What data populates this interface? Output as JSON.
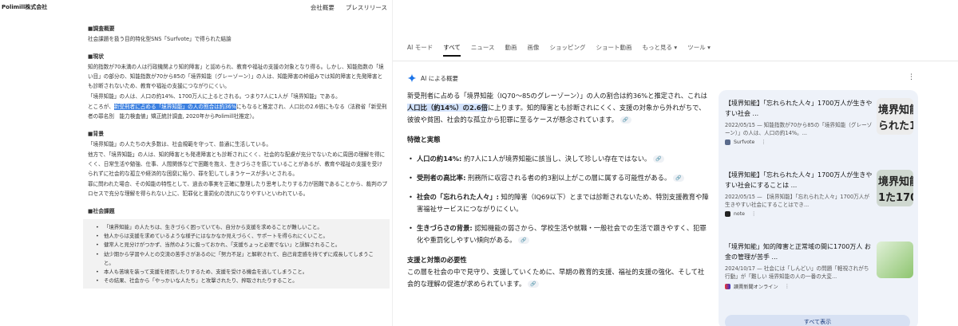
{
  "left": {
    "brand": "Polimill株式会社",
    "nav": [
      "会社概要",
      "プレスリリース"
    ],
    "sections": {
      "title_h": "■調査概要",
      "title_p": "社会課題を扱う目的特化型SNS「Surfvote」で得られた結論",
      "current_h": "■現状",
      "current_p1": "知的指数が70未満の人は行政機関より知的障害」と認められ、教育や福祉の支援の対象となり得る。しかし、知能指数の「境い目」の部分の、知能指数が70から85の「境界知能（グレーゾーン）」の人は、知能障害の枠組みでは知的障害と先発障害とも診断されないため、教育や福祉の支援につながりにくい。",
      "current_p2": "「境界知能」の人は、人口の約14%、1700万人に上るとされる。つまり7人に1人が「境界知能」である。",
      "current_p3a": "ところが、",
      "current_p3_hl": "新受刑者に占める「境界知能」の人の割合は約36%",
      "current_p3b": "にもなると推定され、人口比の2.6倍にもなる（法務省「新受刑者の罪名別　能力検査値」矯正統計調査, 2020年からPolimill社推定）。",
      "bg_h": "■背景",
      "bg_p1": "「境界知能」の人たちの大多数は、社会規範を守って、普通に生活している。",
      "bg_p2": "他方で、「境界知能」の人は、知的障害とも発達障害とも診断されにくく、社会的な配慮が充分でないために周囲の理解を得にくく、日常生活や勉強、仕事、人間関係などで困難を抱え、生きづらさを感じていることがあるが、教育や福祉の支援を受けられずに社会的な孤立や経済的な困窮に陥り、罪を犯してしまうケースが多いとされる。",
      "bg_p3": "罪に問われた場合、その知能の特性として、過去の事実を正確に整理したり思考したりする力が困難であることから、裁判のプロセスで充分な理解を得られない上に、犯罪化と重罰化の流れになりやすいといわれている。",
      "issues_h": "■社会課題",
      "issues": [
        "「境界知能」の人たちは、生きづらく困っていても、自分から支援を求めることが難しいこと。",
        "他人からは支援を求めているような様子にはなかなか見えづらく、サポートを得られにくいこと。",
        "健常人と見分けがつかず、当然のように扱っておかれ、「支援ちょっと必要でない」と誤解されること。",
        "幼少期から学習や人との交流の苦手さがあるのに「努力不足」と解釈されて、自己肯定感を持てずに成長してしまうこと。",
        "本人も苦境を装って支援を拒否したりするため、支援を受ける機会を逃してしまうこと。",
        "その結果、社会から「やっかいな人たち」と攻撃されたり、搾取されたりすること。"
      ]
    }
  },
  "right": {
    "tabs": [
      "AI モード",
      "すべて",
      "ニュース",
      "動画",
      "画像",
      "ショッピング",
      "ショート動画",
      "もっと見る ▾",
      "ツール ▾"
    ],
    "ai_label": "AI による概要",
    "intro_a": "新受刑者に占める「境界知能（IQ70〜85のグレーゾーン）」の人の割合は約36%と推定され、これは",
    "intro_hl": "人口比（約14%）の2.6倍",
    "intro_b": "に上ります。知的障害とも診断されにくく、支援の対象から外れがちで、彼彼や貧困、社会的な孤立から犯罪に至るケースが懸念されています。",
    "features_h": "特徴と実態",
    "bullets": [
      {
        "b": "人口の約14%:",
        "t": "約7人に1人が境界知能に該当し、決して珍しい存在ではない。"
      },
      {
        "b": "受刑者の高比率:",
        "t": "刑務所に収容される者の約3割以上がこの層に属する可能性がある。"
      },
      {
        "b": "社会の「忘れられた人々」:",
        "t": "知的障害（IQ69以下）とまでは診断されないため、特別支援教育や障害福祉サービスにつながりにくい。"
      },
      {
        "b": "生きづらさの背景:",
        "t": "認知機能の弱さから、学校生活や就職・一般社会での生活で躓きやすく、犯罪化や重罰化しやすい傾向がある。"
      }
    ],
    "support_h": "支援と対策の必要性",
    "support_p": "この層を社会の中で見守り、支援していくために、早期の教育的支援、福祉的支援の強化、そして社会的な理解の促進が求められています。",
    "chip": "🔗",
    "kebab": "⋮",
    "cards": [
      {
        "title": "【境界知能】「忘れられた人々」1700万人が生きやすい社会 ...",
        "snippet": "2022/05/15 — 知能指数が70から85の「境界知能（グレーゾーン）」の人は、人口の約14%。...",
        "source": "Surfvote",
        "thumb_text": "境界知能\nられた1700"
      },
      {
        "title": "【境界知能】「忘れられた人々」1700万人が生きやすい社会にすることは ...",
        "snippet": "2022/05/15 — 【境界知能】「忘れられた人々」1700万人が生きやすい社会にすることはでき...",
        "source": "note",
        "thumb_text": "境界知能\n1た1700"
      },
      {
        "title": "「境界知能」知的障害と正常域の間に1700万人 お金の管理が苦手 ...",
        "snippet": "2024/10/17 — 社会には「しんどい」の問題「軽視されがち行動」が「難しい 境界知能の人の一番の大変...",
        "source": "讀賣新聞オンライン",
        "thumb_text": ""
      }
    ],
    "show_all": "すべて表示"
  },
  "colors": {
    "highlight_selection": "#3a7fe0",
    "ai_highlight": "#d3e3fd",
    "cards_bg": "#eef2f9",
    "ai_star": "#1a73e8"
  }
}
